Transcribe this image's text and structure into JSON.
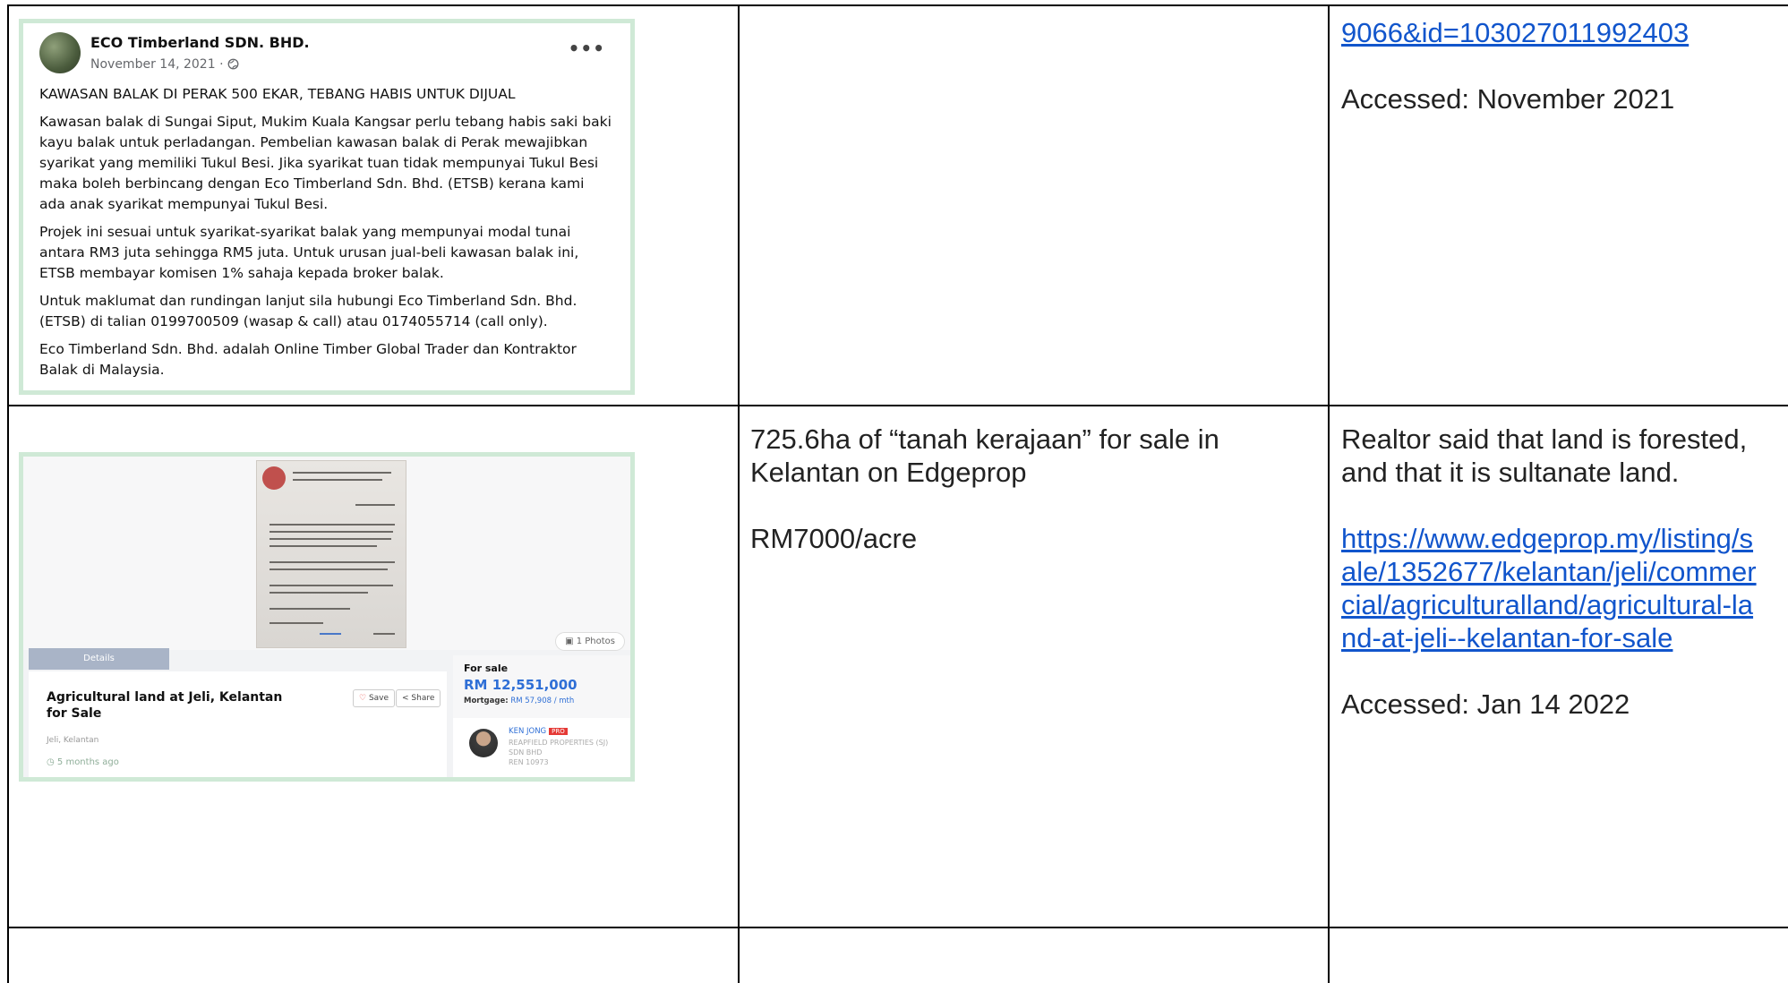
{
  "row1": {
    "fb_post": {
      "page_name": "ECO Timberland SDN. BHD.",
      "date": "November 14, 2021 · ",
      "more": "•••",
      "headline": "KAWASAN BALAK DI PERAK 500 EKAR, TEBANG HABIS UNTUK DIJUAL",
      "paragraphs": [
        "Kawasan balak di Sungai Siput, Mukim Kuala Kangsar perlu tebang habis saki baki kayu balak untuk perladangan. Pembelian kawasan balak di Perak mewajibkan syarikat yang memiliki Tukul Besi. Jika syarikat tuan tidak mempunyai Tukul Besi maka boleh berbincang dengan Eco Timberland Sdn. Bhd. (ETSB) kerana kami ada anak syarikat mempunyai Tukul Besi.",
        "Projek ini sesuai untuk syarikat-syarikat balak yang mempunyai modal tunai antara RM3 juta sehingga RM5 juta. Untuk urusan jual-beli kawasan balak ini, ETSB membayar komisen 1% sahaja kepada broker balak.",
        "Untuk maklumat dan rundingan lanjut sila hubungi Eco Timberland Sdn. Bhd. (ETSB) di talian 0199700509 (wasap & call) atau 0174055714 (call only).",
        "Eco Timberland Sdn. Bhd. adalah Online Timber Global Trader dan Kontraktor Balak di Malaysia."
      ]
    },
    "source_link_tail": "9066&id=103027011992403",
    "accessed": "Accessed: November 2021"
  },
  "row2": {
    "listing": {
      "photos_badge": "1 Photos",
      "tab_details": "Details",
      "title": "Agricultural land at Jeli, Kelantan for Sale",
      "save": "Save",
      "share": "Share",
      "location": "Jeli, Kelantan",
      "posted": "5 months ago",
      "for_sale": "For sale",
      "price": "RM 12,551,000",
      "mortgage_label": "Mortgage:",
      "mortgage_value": "RM 57,908 / mth",
      "agent_name": "KEN JONG",
      "agent_badge": "PRO",
      "agent_company": "REAPFIELD PROPERTIES (SJ) SDN BHD",
      "agent_ren": "REN 10973"
    },
    "description": "725.6ha of “tanah kerajaan” for sale in Kelantan on Edgeprop",
    "price_per_acre": "RM7000/acre",
    "note": "Realtor said that land is forested, and that it is sultanate land.",
    "url_lines": [
      "https://www.edgeprop.my/listing/s",
      "ale/1352677/kelantan/jeli/commer",
      "cial/agriculturalland/agricultural-la",
      "nd-at-jeli--kelantan-for-sale"
    ],
    "accessed": "Accessed: Jan 14 2022"
  }
}
